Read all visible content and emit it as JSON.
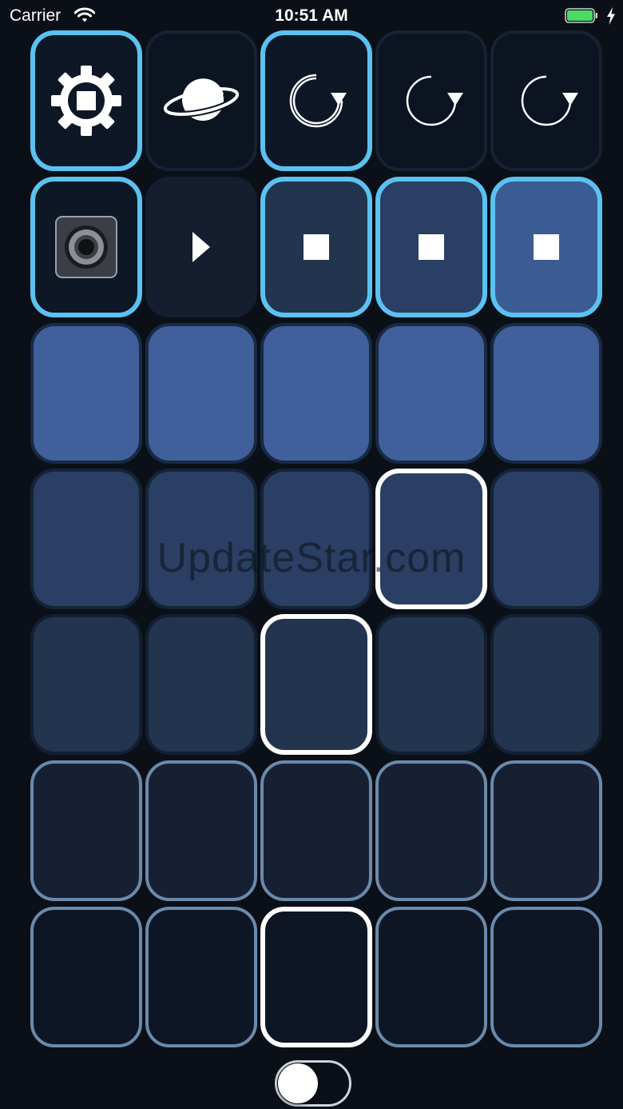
{
  "status_bar": {
    "carrier": "Carrier",
    "time": "10:51 AM",
    "wifi_icon": "wifi-icon",
    "battery_icon": "battery-icon",
    "charging_icon": "charging-bolt-icon"
  },
  "colors": {
    "background": "#0b1018",
    "accent_cyan": "#5bc2f0",
    "white_outline": "#ffffff",
    "steel_outline": "#6a8aab",
    "pad_dark": "#0e1726",
    "pad_blue_1": "#23344f",
    "pad_blue_2": "#2a3f63",
    "pad_blue_3": "#3b5b93",
    "pad_blue_4": "#415f9a",
    "battery_green": "#4cd964"
  },
  "grid": {
    "rows": [
      [
        {
          "name": "gear-stop-pad",
          "icon": "gear-stop-icon",
          "fill": "#0e1726",
          "border": "#5bc2f0"
        },
        {
          "name": "planet-pad",
          "icon": "planet-icon",
          "fill": "#0c1421",
          "border": "#162234"
        },
        {
          "name": "loop-record-pad-1",
          "icon": "loop-icon",
          "fill": "#0e1726",
          "border": "#5bc2f0"
        },
        {
          "name": "loop-record-pad-2",
          "icon": "loop-icon",
          "fill": "#0c1421",
          "border": "#162234"
        },
        {
          "name": "loop-record-pad-3",
          "icon": "loop-icon",
          "fill": "#0c1421",
          "border": "#162234"
        }
      ],
      [
        {
          "name": "speaker-pad",
          "icon": "speaker-icon",
          "fill": "#0e1726",
          "border": "#5bc2f0"
        },
        {
          "name": "play-pad",
          "icon": "play-icon",
          "fill": "#141e2e",
          "border": "#141e2e"
        },
        {
          "name": "stop-pad-1",
          "icon": "stop-icon",
          "fill": "#23344f",
          "border": "#5bc2f0"
        },
        {
          "name": "stop-pad-2",
          "icon": "stop-icon",
          "fill": "#2a3f63",
          "border": "#5bc2f0"
        },
        {
          "name": "stop-pad-3",
          "icon": "stop-icon",
          "fill": "#3b5b93",
          "border": "#5bc2f0"
        }
      ],
      [
        {
          "name": "sound-pad-r3-c1",
          "icon": "",
          "fill": "#415f9a",
          "border": "#182a44"
        },
        {
          "name": "sound-pad-r3-c2",
          "icon": "",
          "fill": "#415f9a",
          "border": "#182a44"
        },
        {
          "name": "sound-pad-r3-c3",
          "icon": "",
          "fill": "#415f9a",
          "border": "#182a44"
        },
        {
          "name": "sound-pad-r3-c4",
          "icon": "",
          "fill": "#415f9a",
          "border": "#182a44"
        },
        {
          "name": "sound-pad-r3-c5",
          "icon": "",
          "fill": "#415f9a",
          "border": "#182a44"
        }
      ],
      [
        {
          "name": "sound-pad-r4-c1",
          "icon": "",
          "fill": "#2a3f63",
          "border": "#152338"
        },
        {
          "name": "sound-pad-r4-c2",
          "icon": "",
          "fill": "#2a3f63",
          "border": "#152338"
        },
        {
          "name": "sound-pad-r4-c3",
          "icon": "",
          "fill": "#2a3f63",
          "border": "#152338"
        },
        {
          "name": "sound-pad-r4-c4",
          "icon": "",
          "fill": "#2a3f63",
          "border": "#ffffff"
        },
        {
          "name": "sound-pad-r4-c5",
          "icon": "",
          "fill": "#2a3f63",
          "border": "#152338"
        }
      ],
      [
        {
          "name": "sound-pad-r5-c1",
          "icon": "",
          "fill": "#23344f",
          "border": "#131f31"
        },
        {
          "name": "sound-pad-r5-c2",
          "icon": "",
          "fill": "#23344f",
          "border": "#131f31"
        },
        {
          "name": "sound-pad-r5-c3",
          "icon": "",
          "fill": "#23344f",
          "border": "#ffffff"
        },
        {
          "name": "sound-pad-r5-c4",
          "icon": "",
          "fill": "#23344f",
          "border": "#131f31"
        },
        {
          "name": "sound-pad-r5-c5",
          "icon": "",
          "fill": "#23344f",
          "border": "#131f31"
        }
      ],
      [
        {
          "name": "sound-pad-r6-c1",
          "icon": "",
          "fill": "#172033",
          "border": "#6a8aab"
        },
        {
          "name": "sound-pad-r6-c2",
          "icon": "",
          "fill": "#172033",
          "border": "#6a8aab"
        },
        {
          "name": "sound-pad-r6-c3",
          "icon": "",
          "fill": "#172033",
          "border": "#6a8aab"
        },
        {
          "name": "sound-pad-r6-c4",
          "icon": "",
          "fill": "#172033",
          "border": "#6a8aab"
        },
        {
          "name": "sound-pad-r6-c5",
          "icon": "",
          "fill": "#172033",
          "border": "#6a8aab"
        }
      ],
      [
        {
          "name": "sound-pad-r7-c1",
          "icon": "",
          "fill": "#0e1625",
          "border": "#6a8aab"
        },
        {
          "name": "sound-pad-r7-c2",
          "icon": "",
          "fill": "#0e1625",
          "border": "#6a8aab"
        },
        {
          "name": "sound-pad-r7-c3",
          "icon": "",
          "fill": "#0e1625",
          "border": "#ffffff"
        },
        {
          "name": "sound-pad-r7-c4",
          "icon": "",
          "fill": "#0e1625",
          "border": "#6a8aab"
        },
        {
          "name": "sound-pad-r7-c5",
          "icon": "",
          "fill": "#0e1625",
          "border": "#6a8aab"
        }
      ]
    ]
  },
  "toggle": {
    "on": false
  },
  "watermark": "UpdateStar.com"
}
